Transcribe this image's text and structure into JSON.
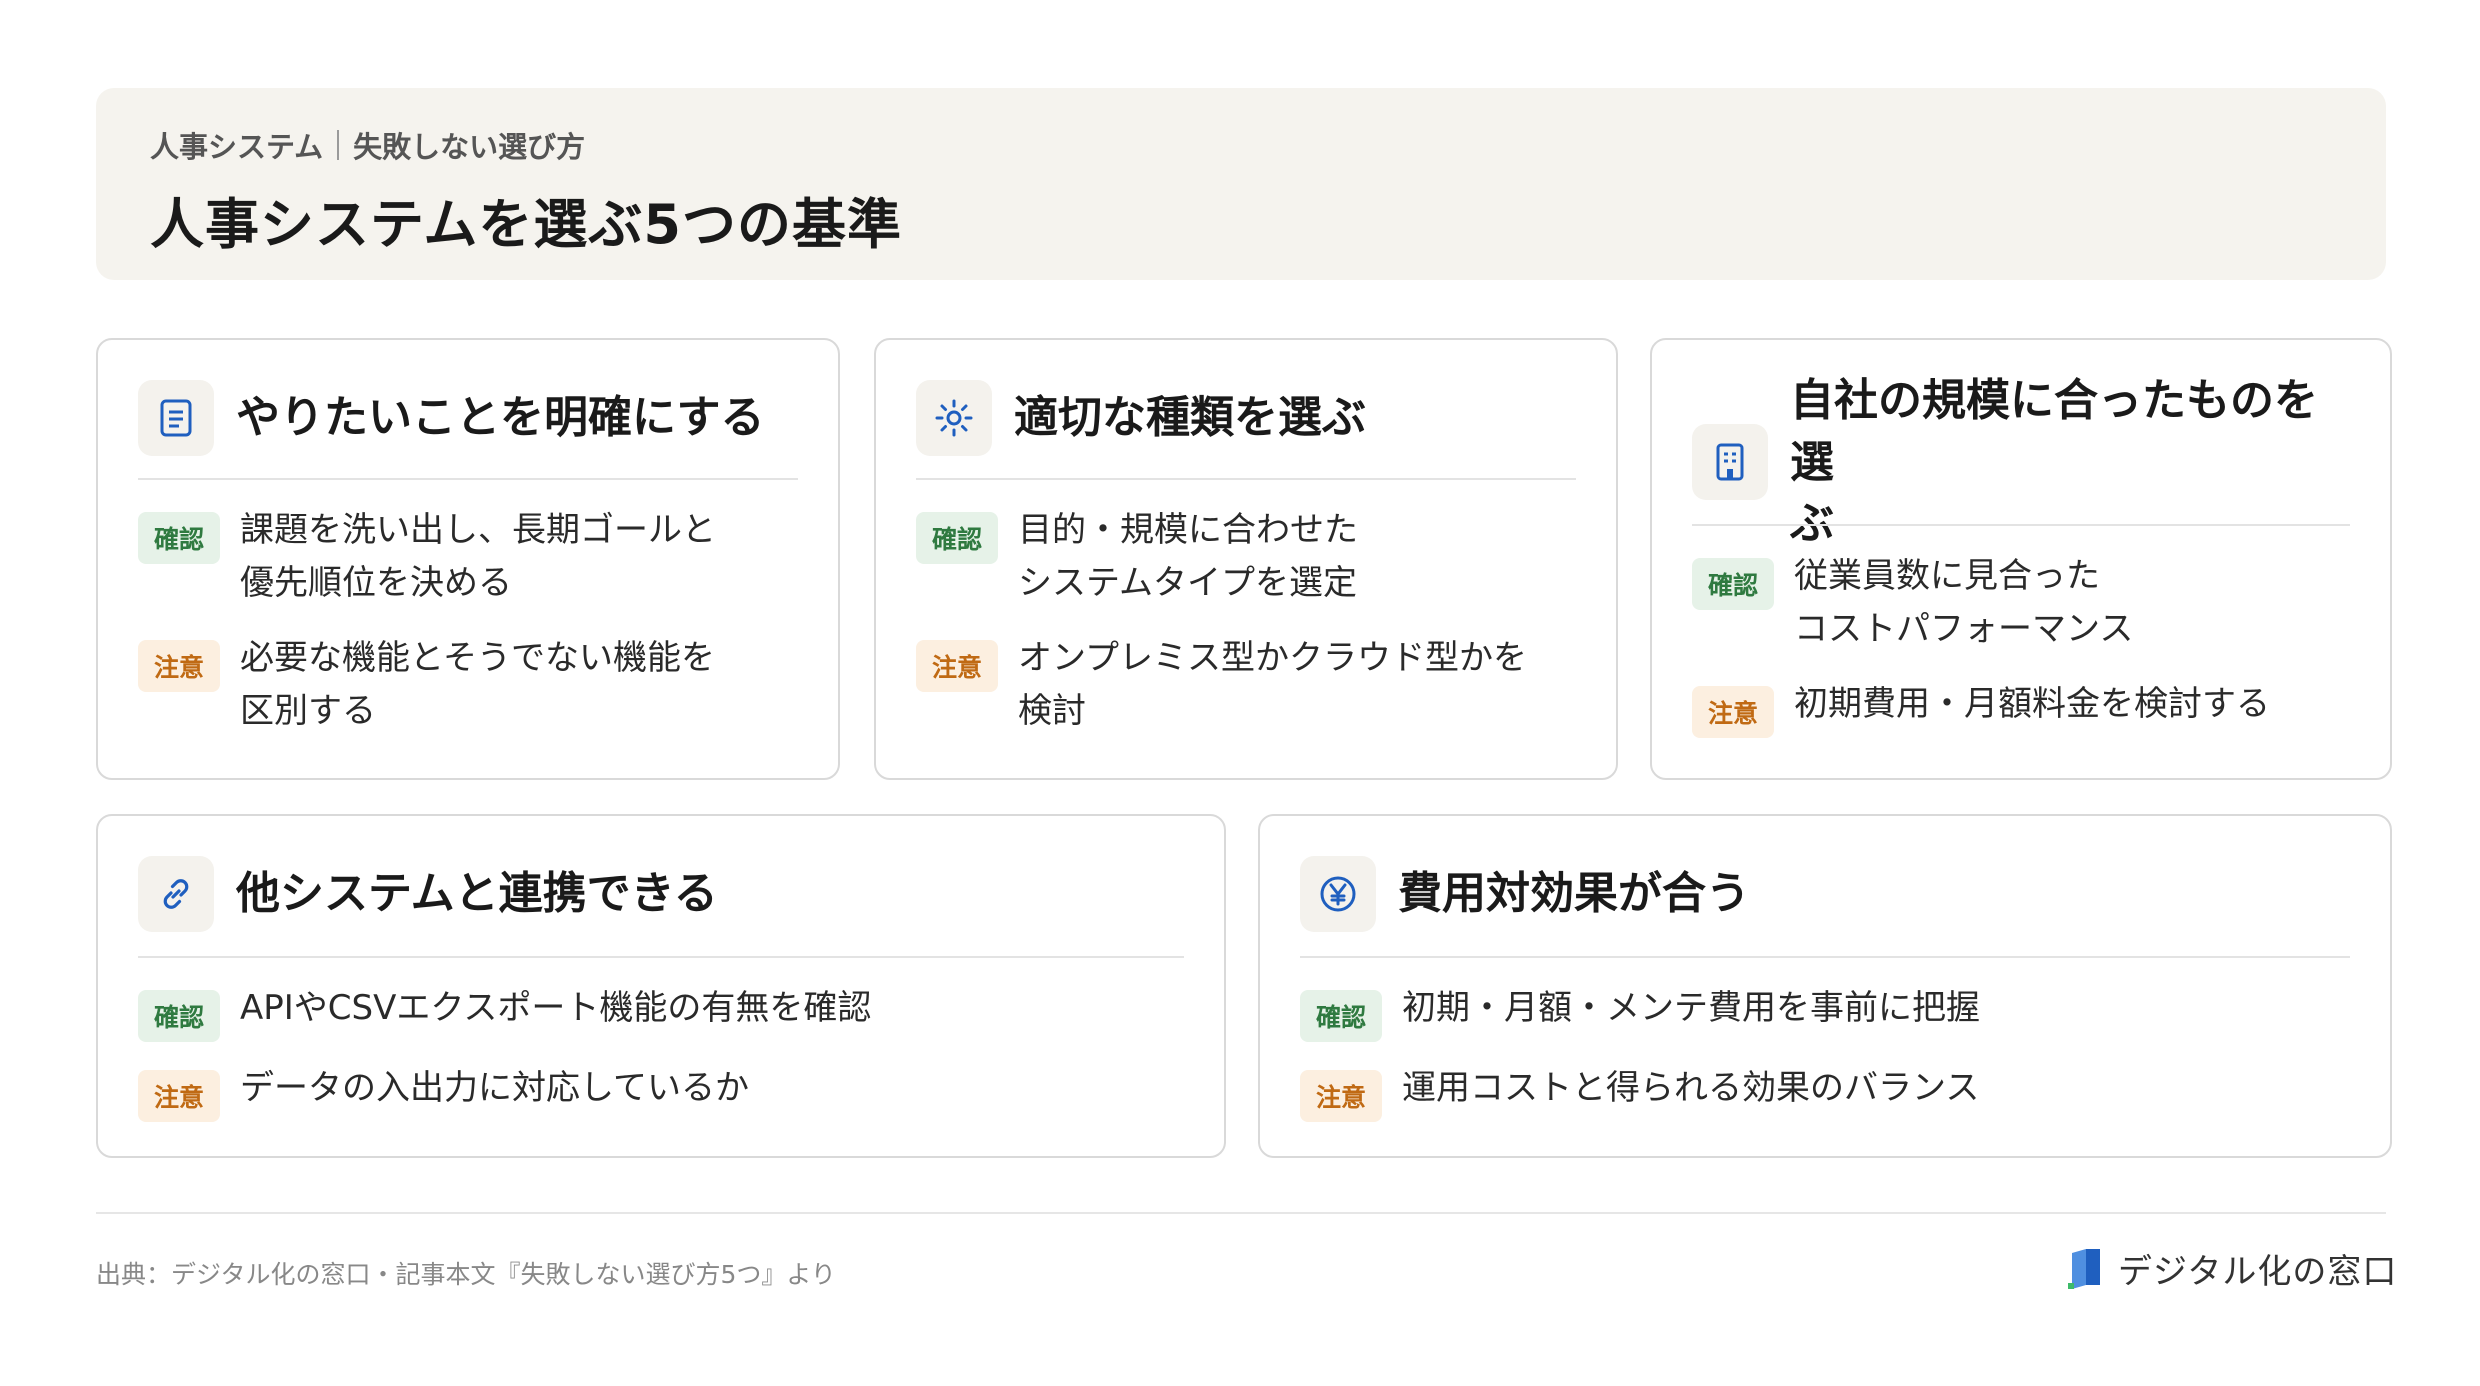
{
  "header": {
    "breadcrumb": [
      "人事システム",
      "失敗しない選び方"
    ],
    "title": "人事システムを選ぶ5つの基準"
  },
  "colors": {
    "confirm_badge_bg": "#e6f2e8",
    "confirm_badge_text": "#2f7a40",
    "caution_badge_bg": "#fcefe0",
    "caution_badge_text": "#c06a14",
    "icon_accent": "#1f5fbf",
    "header_bg": "#f5f3ee"
  },
  "cards": [
    {
      "icon": "document-icon",
      "title": "やりたいことを明確にする",
      "confirm_label": "確認",
      "confirm_text": "課題を洗い出し、長期ゴールと\n優先順位を決める",
      "caution_label": "注意",
      "caution_text": "必要な機能とそうでない機能を\n区別する"
    },
    {
      "icon": "sun-gear-icon",
      "title": "適切な種類を選ぶ",
      "confirm_label": "確認",
      "confirm_text": "目的・規模に合わせた\nシステムタイプを選定",
      "caution_label": "注意",
      "caution_text": "オンプレミス型かクラウド型かを\n検討"
    },
    {
      "icon": "building-icon",
      "title": "自社の規模に合ったものを選\nぶ",
      "confirm_label": "確認",
      "confirm_text": "従業員数に見合った\nコストパフォーマンス",
      "caution_label": "注意",
      "caution_text": "初期費用・月額料金を検討する"
    },
    {
      "icon": "link-icon",
      "title": "他システムと連携できる",
      "confirm_label": "確認",
      "confirm_text": "APIやCSVエクスポート機能の有無を確認",
      "caution_label": "注意",
      "caution_text": "データの入出力に対応しているか"
    },
    {
      "icon": "yen-icon",
      "title": "費用対効果が合う",
      "confirm_label": "確認",
      "confirm_text": "初期・月額・メンテ費用を事前に把握",
      "caution_label": "注意",
      "caution_text": "運用コストと得られる効果のバランス"
    }
  ],
  "footer": {
    "source": "出典：デジタル化の窓口・記事本文『失敗しない選び方5つ』より",
    "logo_text": "デジタル化の窓口",
    "logo_icon": "book-logo-icon"
  }
}
